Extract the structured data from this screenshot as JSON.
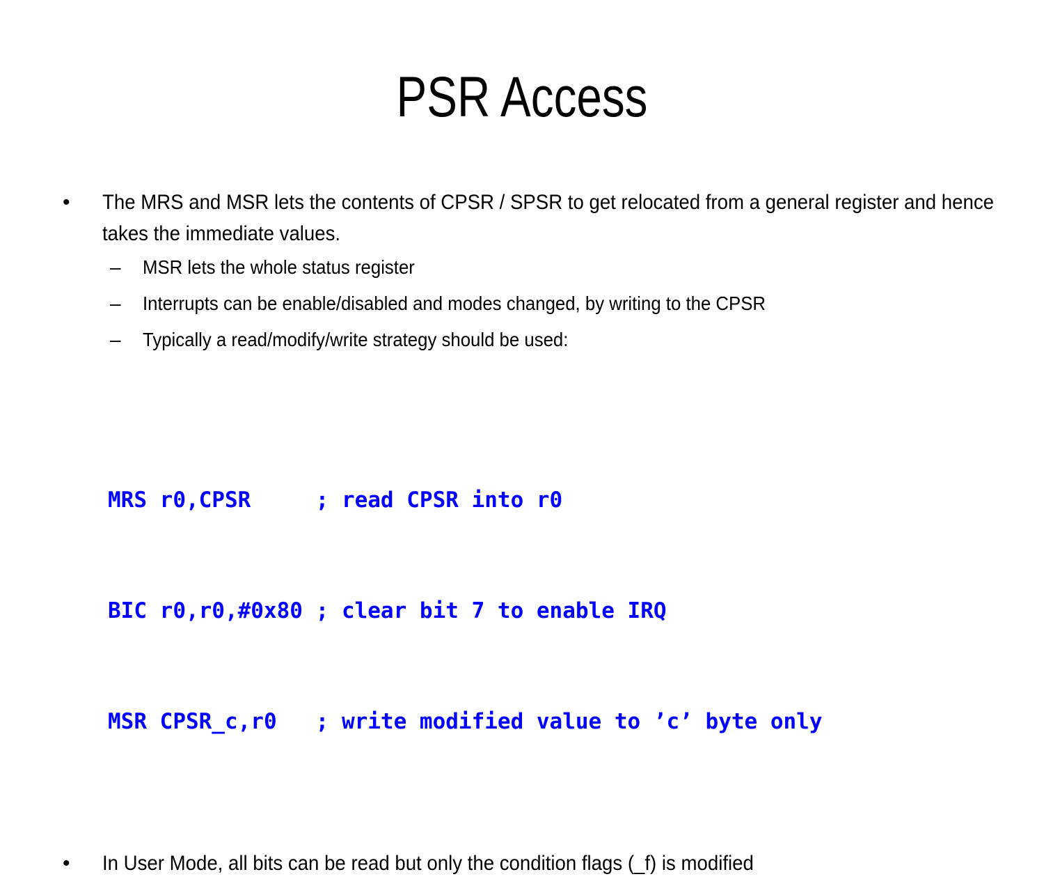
{
  "slide": {
    "title": "PSR Access",
    "accent_color": "#0000FF",
    "text_color": "#000000",
    "background_color": "#FFFFFF",
    "bullet_marker_l1": "•",
    "bullet_marker_l2": "–",
    "content": {
      "bullet_1": "The MRS and MSR lets the contents of CPSR / SPSR to get relocated from a general register and hence takes the immediate values.",
      "sub_bullets": [
        "MSR lets the whole status register",
        "Interrupts can be enable/disabled and modes changed, by writing to the CPSR",
        "Typically a read/modify/write strategy should be used:"
      ],
      "code": {
        "line_1": "MRS r0,CPSR     ; read CPSR into r0",
        "line_2": "BIC r0,r0,#0x80 ; clear bit 7 to enable IRQ",
        "line_3": "MSR CPSR_c,r0   ; write modified value to ’c’ byte only"
      },
      "bullet_2": "In User Mode, all bits can be read but only the condition flags (_f) is modified"
    }
  }
}
